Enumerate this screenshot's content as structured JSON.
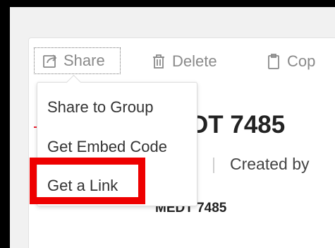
{
  "toolbar": {
    "share_label": "Share",
    "delete_label": "Delete",
    "copy_label": "Cop"
  },
  "share_menu": {
    "items": [
      "Share to Group",
      "Get Embed Code",
      "Get a Link"
    ]
  },
  "content": {
    "title": "DT 7485",
    "meta_label": "Created by",
    "sub_label": "MEDT 7485"
  },
  "icons": {
    "share": "share-icon",
    "delete": "trash-icon",
    "copy": "clipboard-icon"
  },
  "colors": {
    "highlight": "#ee0000",
    "accent": "#dd2233"
  }
}
